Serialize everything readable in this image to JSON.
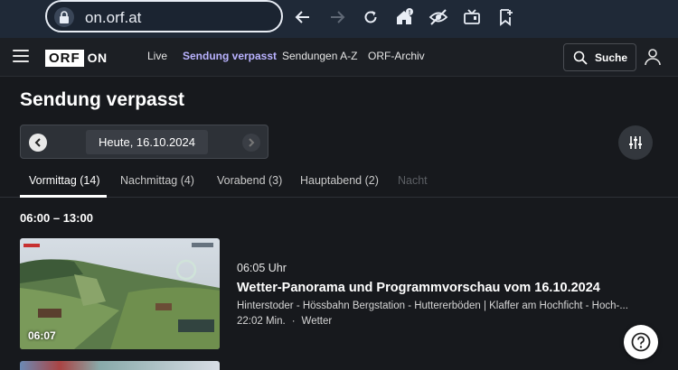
{
  "browser": {
    "url": "on.orf.at",
    "notification_badge": "!"
  },
  "header": {
    "logo_box": "ORF",
    "logo_on": "ON",
    "nav": [
      "Live",
      "Sendung verpasst",
      "Sendungen A-Z",
      "ORF-Archiv"
    ],
    "active_nav": "Sendung verpasst",
    "search_label": "Suche"
  },
  "page": {
    "title": "Sendung verpasst",
    "date": "Heute, 16.10.2024",
    "tabs": [
      "Vormittag (14)",
      "Nachmittag (4)",
      "Vorabend (3)",
      "Hauptabend (2)",
      "Nacht"
    ],
    "active_tab": "Vormittag (14)",
    "disabled_tab": "Nacht",
    "time_range": "06:00 – 13:00"
  },
  "episode": {
    "duration_overlay": "06:07",
    "time": "06:05 Uhr",
    "title": "Wetter-Panorama und Programmvorschau vom 16.10.2024",
    "description": "Hinterstoder - Hössbahn Bergstation - Huttererböden | Klaffer am Hochficht - Hoch-...",
    "length": "22:02 Min.",
    "category": "Wetter",
    "meta_separator": "·"
  },
  "help": {
    "icon": "question-icon"
  },
  "colors": {
    "accent": "#b9b2ff",
    "background": "#17191d",
    "chrome": "#1f2937"
  }
}
